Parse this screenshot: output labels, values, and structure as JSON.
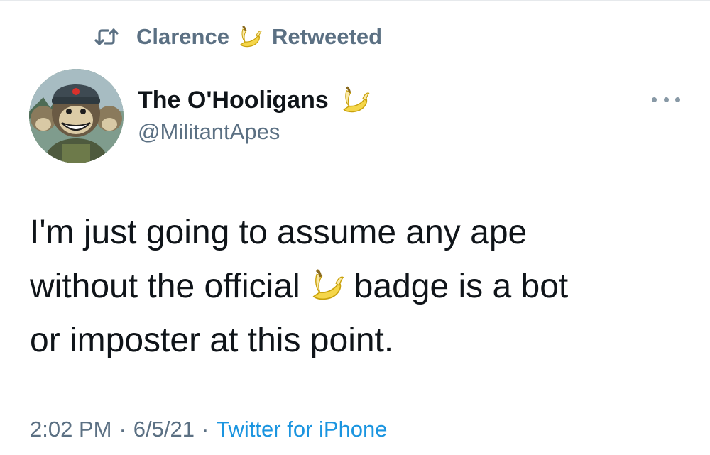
{
  "retweet_context": {
    "icon": "retweet-icon",
    "name": "Clarence",
    "badge_icon": "banana-icon",
    "label": "Retweeted"
  },
  "author": {
    "avatar_icon": "ape-avatar",
    "display_name": "The O'Hooligans",
    "badge_icon": "banana-icon",
    "handle": "@MilitantApes"
  },
  "more_menu": {
    "icon": "more-horizontal-icon"
  },
  "tweet": {
    "line1": "I'm just going to assume any ape",
    "line2_before": "without the official",
    "line2_after": "badge is a bot",
    "line3": "or imposter at this point.",
    "inline_icon": "banana-icon"
  },
  "meta": {
    "time": "2:02 PM",
    "separator": "·",
    "date": "6/5/21",
    "source": "Twitter for iPhone"
  },
  "colors": {
    "text_primary": "#0f1419",
    "text_secondary": "#5b7083",
    "link": "#1b95e0",
    "banana_yellow": "#f5d64a"
  }
}
